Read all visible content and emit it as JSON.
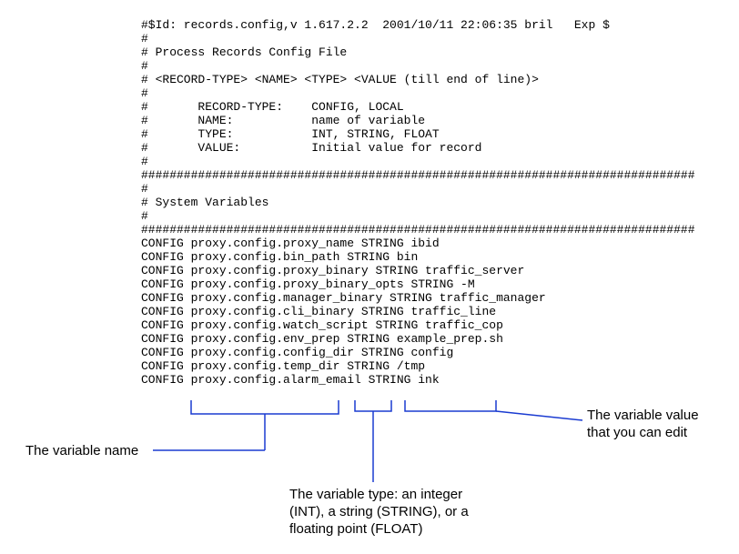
{
  "header": {
    "id_line": "#$Id: records.config,v 1.617.2.2  2001/10/11 22:06:35 bril   Exp $",
    "title": "# Process Records Config File",
    "syntax": "# <RECORD-TYPE> <NAME> <TYPE> <VALUE (till end of line)>",
    "field_record_type_label": "RECORD-TYPE:",
    "field_record_type_value": "CONFIG, LOCAL",
    "field_name_label": "NAME:",
    "field_name_value": "name of variable",
    "field_type_label": "TYPE:",
    "field_type_value": "INT, STRING, FLOAT",
    "field_value_label": "VALUE:",
    "field_value_value": "Initial value for record",
    "section_title": "# System Variables",
    "hash_rule": "##############################################################################"
  },
  "records": [
    {
      "type": "CONFIG",
      "name": "proxy.config.proxy_name",
      "vtype": "STRING",
      "value": "ibid"
    },
    {
      "type": "CONFIG",
      "name": "proxy.config.bin_path",
      "vtype": "STRING",
      "value": "bin"
    },
    {
      "type": "CONFIG",
      "name": "proxy.config.proxy_binary",
      "vtype": "STRING",
      "value": "traffic_server"
    },
    {
      "type": "CONFIG",
      "name": "proxy.config.proxy_binary_opts",
      "vtype": "STRING",
      "value": "-M"
    },
    {
      "type": "CONFIG",
      "name": "proxy.config.manager_binary",
      "vtype": "STRING",
      "value": "traffic_manager"
    },
    {
      "type": "CONFIG",
      "name": "proxy.config.cli_binary",
      "vtype": "STRING",
      "value": "traffic_line"
    },
    {
      "type": "CONFIG",
      "name": "proxy.config.watch_script",
      "vtype": "STRING",
      "value": "traffic_cop"
    },
    {
      "type": "CONFIG",
      "name": "proxy.config.env_prep",
      "vtype": "STRING",
      "value": "example_prep.sh"
    },
    {
      "type": "CONFIG",
      "name": "proxy.config.config_dir",
      "vtype": "STRING",
      "value": "config"
    },
    {
      "type": "CONFIG",
      "name": "proxy.config.temp_dir",
      "vtype": "STRING",
      "value": "/tmp"
    },
    {
      "type": "CONFIG",
      "name": "proxy.config.alarm_email",
      "vtype": "STRING",
      "value": "ink"
    }
  ],
  "annotations": {
    "name_label": "The variable name",
    "type_label": "The variable type: an integer (INT), a string (STRING), or a floating point (FLOAT)",
    "value_label": "The variable value that you can edit"
  }
}
